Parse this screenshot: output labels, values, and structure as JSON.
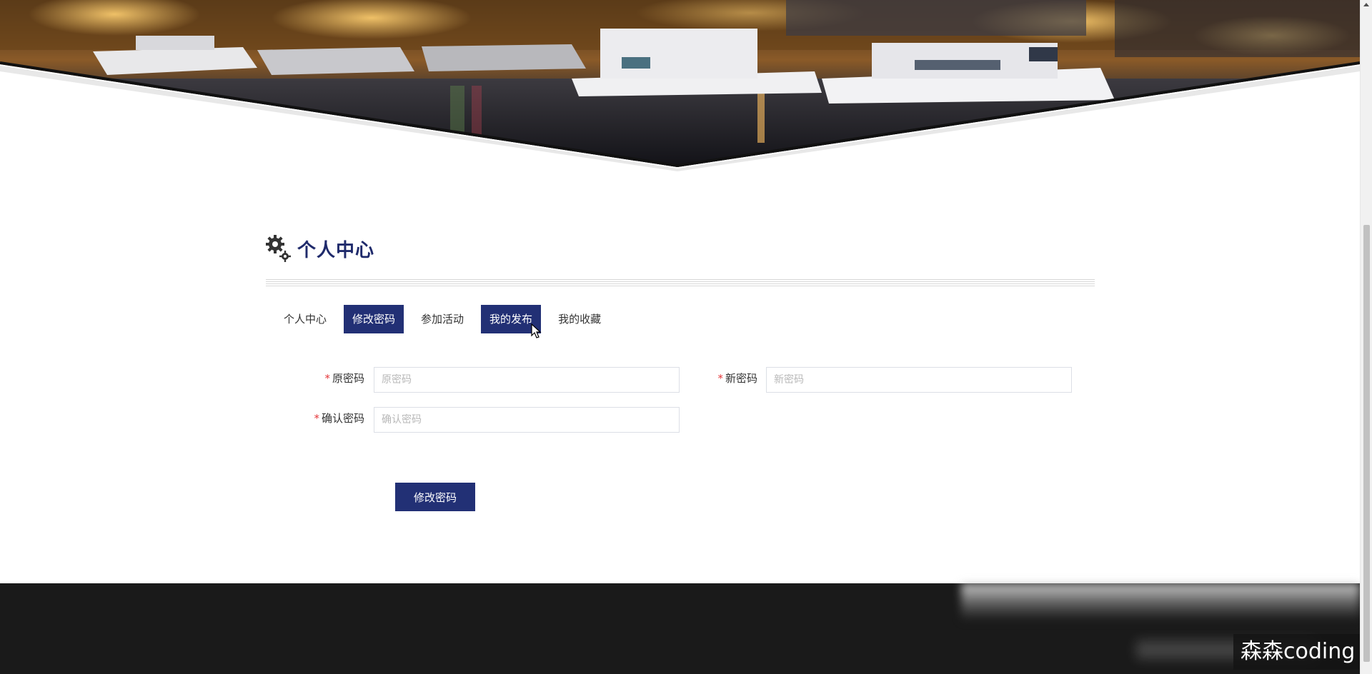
{
  "banner": {
    "scene_icon": "marina-night-banner"
  },
  "header": {
    "title": "个人中心",
    "icon": "gear-icon"
  },
  "tabs": [
    {
      "label": "个人中心",
      "active": false
    },
    {
      "label": "修改密码",
      "active": true
    },
    {
      "label": "参加活动",
      "active": false
    },
    {
      "label": "我的发布",
      "active": true
    },
    {
      "label": "我的收藏",
      "active": false
    }
  ],
  "form": {
    "old_password": {
      "label": "原密码",
      "placeholder": "原密码",
      "required_mark": "*"
    },
    "new_password": {
      "label": "新密码",
      "placeholder": "新密码",
      "required_mark": "*"
    },
    "confirm_password": {
      "label": "确认密码",
      "placeholder": "确认密码",
      "required_mark": "*"
    },
    "submit_label": "修改密码"
  },
  "watermark": {
    "text": "森森coding"
  },
  "colors": {
    "accent": "#223075",
    "title": "#1f2a6b",
    "required": "#e5383b",
    "footer": "#1a1a1a"
  }
}
